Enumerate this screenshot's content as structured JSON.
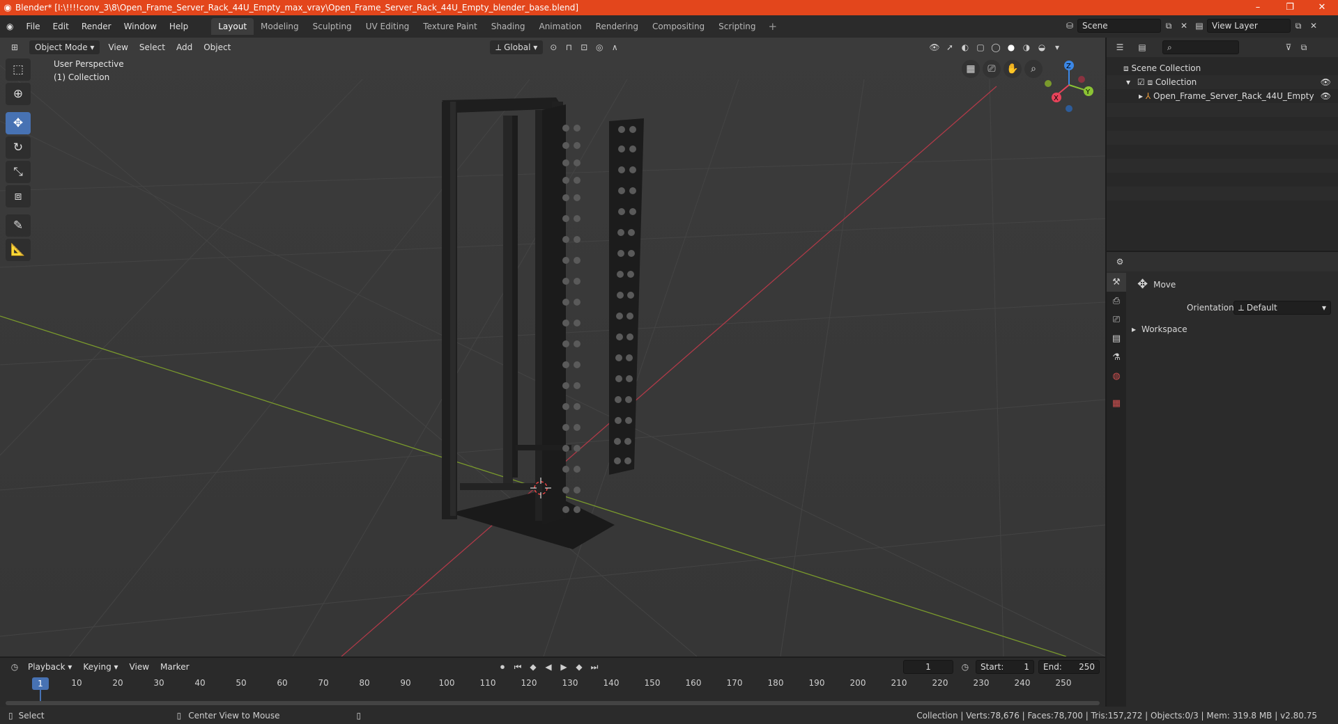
{
  "window": {
    "title": "Blender* [I:\\!!!!conv_3\\8\\Open_Frame_Server_Rack_44U_Empty_max_vray\\Open_Frame_Server_Rack_44U_Empty_blender_base.blend]",
    "minimize": "–",
    "maximize": "❐",
    "close": "✕"
  },
  "menu": [
    "File",
    "Edit",
    "Render",
    "Window",
    "Help"
  ],
  "workspaces": [
    "Layout",
    "Modeling",
    "Sculpting",
    "UV Editing",
    "Texture Paint",
    "Shading",
    "Animation",
    "Rendering",
    "Compositing",
    "Scripting"
  ],
  "active_workspace": "Layout",
  "add_workspace": "+",
  "scene": {
    "name": "Scene",
    "view_layer": "View Layer"
  },
  "viewport": {
    "mode": "Object Mode",
    "menus": [
      "View",
      "Select",
      "Add",
      "Object"
    ],
    "orientation": "Global",
    "perspective_label": "User Perspective",
    "collection_label": "(1) Collection"
  },
  "gizmo": {
    "x": "X",
    "y": "Y",
    "z": "Z",
    "colors": {
      "x": "#e8435a",
      "y": "#8bc334",
      "z": "#3b87e6"
    }
  },
  "outliner": {
    "search_placeholder": "",
    "scene_collection": "Scene Collection",
    "collection": "Collection",
    "object": "Open_Frame_Server_Rack_44U_Empty"
  },
  "properties": {
    "tool_name": "Move",
    "orientation_label": "Orientation",
    "orientation_value": "Default",
    "workspace_panel": "Workspace"
  },
  "timeline": {
    "menus": [
      "Playback",
      "Keying",
      "View",
      "Marker"
    ],
    "current_frame": "1",
    "start_label": "Start:",
    "start_value": "1",
    "end_label": "End:",
    "end_value": "250",
    "ruler_labels": [
      "10",
      "20",
      "30",
      "40",
      "50",
      "60",
      "70",
      "80",
      "90",
      "100",
      "110",
      "120",
      "130",
      "140",
      "150",
      "160",
      "170",
      "180",
      "190",
      "200",
      "210",
      "220",
      "230",
      "240",
      "250"
    ],
    "playhead": "1"
  },
  "status": {
    "select": "Select",
    "center_view": "Center View to Mouse",
    "stats": "Collection | Verts:78,676 | Faces:78,700 | Tris:157,272 | Objects:0/3 | Mem: 319.8 MB | v2.80.75"
  },
  "accent": "#4772b3",
  "titlebar_color": "#e3461c"
}
